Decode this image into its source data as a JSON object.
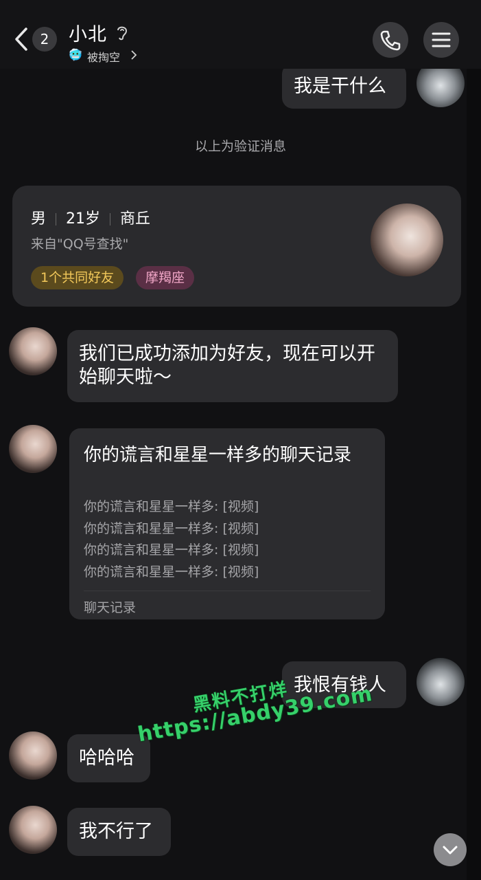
{
  "header": {
    "unread_count": "2",
    "contact_name": "小北",
    "status_emoji": "🥶",
    "status_text": "被掏空"
  },
  "messages": {
    "m1": "我是干什么",
    "system_note": "以上为验证消息",
    "profile": {
      "gender": "男",
      "age": "21岁",
      "city": "商丘",
      "source": "来自\"QQ号查找\"",
      "tag_mutual": "1个共同好友",
      "tag_zodiac": "摩羯座"
    },
    "m2": "我们已成功添加为好友，现在可以开始聊天啦～",
    "record": {
      "title": "你的谎言和星星一样多的聊天记录",
      "lines": [
        "你的谎言和星星一样多: [视频]",
        "你的谎言和星星一样多: [视频]",
        "你的谎言和星星一样多: [视频]",
        "你的谎言和星星一样多: [视频]"
      ],
      "footer": "聊天记录"
    },
    "m3": "我恨有钱人",
    "m4": "哈哈哈",
    "m5": "我不行了"
  },
  "watermark": {
    "line1": "黑料不打烊",
    "line2": "https://abdy39.com"
  },
  "colors": {
    "background": "#111113",
    "bubble": "#2c2c2f",
    "watermark": "#36d06a",
    "tag_friends_text": "#f2c85a",
    "tag_zodiac_text": "#f2a7c8"
  }
}
